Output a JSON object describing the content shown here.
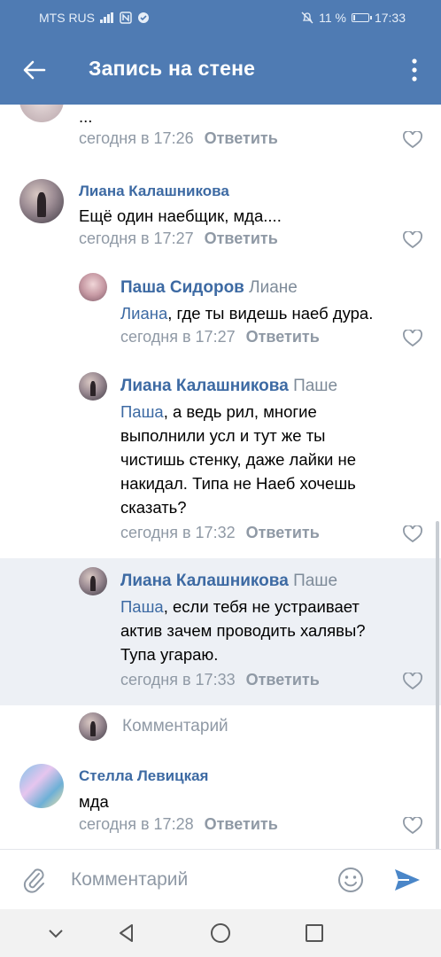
{
  "status": {
    "carrier": "MTS RUS",
    "battery_text": "11 %",
    "battery_level": 0.11,
    "time": "17:33",
    "icons": [
      "signal-icon",
      "nfc-icon",
      "vpn-icon",
      "mute-icon",
      "battery-icon"
    ]
  },
  "header": {
    "title": "Запись на стене",
    "back_icon": "arrow-left-icon",
    "menu_icon": "more-vertical-icon"
  },
  "comments": {
    "top": {
      "text": "...",
      "time": "сегодня в 17:26",
      "reply": "Ответить"
    },
    "liana1": {
      "author": "Лиана Калашникова",
      "text": "Ещё один наебщик, мда....",
      "time": "сегодня в 17:27",
      "reply": "Ответить"
    },
    "pasha": {
      "author": "Паша Сидоров",
      "to": "Лиане",
      "mention": "Лиана",
      "text": ", где ты видешь наеб дура.",
      "time": "сегодня в 17:27",
      "reply": "Ответить"
    },
    "liana2": {
      "author": "Лиана Калашникова",
      "to": "Паше",
      "mention": "Паша",
      "line1": ", а ведь рил, многие",
      "line2": "выполнили усл и тут же ты",
      "line3": "чистишь стенку, даже лайки не",
      "line4": "накидал. Типа не Наеб хочешь",
      "line5": "сказать?",
      "time": "сегодня в 17:32",
      "reply": "Ответить"
    },
    "liana3": {
      "author": "Лиана Калашникова",
      "to": "Паше",
      "mention": "Паша",
      "line1": ", если тебя не устраивает",
      "line2": "актив зачем проводить халявы?",
      "line3": "Тупа угараю.",
      "time": "сегодня в 17:33",
      "reply": "Ответить"
    },
    "reply_placeholder": "Комментарий",
    "stella": {
      "author": "Стелла Левицкая",
      "text": "мда",
      "time": "сегодня в 17:28",
      "reply": "Ответить"
    }
  },
  "input": {
    "placeholder": "Комментарий",
    "attach_icon": "paperclip-icon",
    "emoji_icon": "smile-icon",
    "send_icon": "send-icon"
  },
  "navbar": {
    "icons": [
      "nav-hide-icon",
      "nav-back-icon",
      "nav-home-icon",
      "nav-recents-icon"
    ]
  },
  "colors": {
    "accent": "#4f7bb3",
    "link": "#3d6aa3",
    "meta": "#8f99a5",
    "highlight": "#edf0f5"
  }
}
